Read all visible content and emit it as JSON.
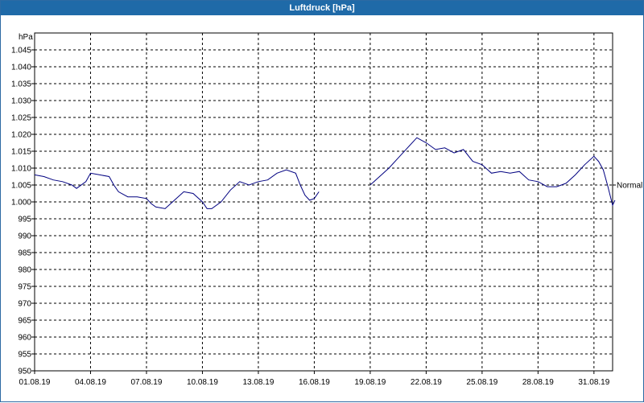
{
  "window": {
    "title": "Luftdruck [hPa]"
  },
  "chart_data": {
    "type": "line",
    "title": "Luftdruck [hPa]",
    "ylabel": "hPa",
    "xlabel": "",
    "ylim": [
      950,
      1050
    ],
    "y_ticks": [
      950,
      955,
      960,
      965,
      970,
      975,
      980,
      985,
      990,
      995,
      1000,
      1005,
      1010,
      1015,
      1020,
      1025,
      1030,
      1035,
      1040,
      1045
    ],
    "y_tick_labels": [
      "950",
      "955",
      "960",
      "965",
      "970",
      "975",
      "980",
      "985",
      "990",
      "995",
      "1.000",
      "1.005",
      "1.010",
      "1.015",
      "1.020",
      "1.025",
      "1.030",
      "1.035",
      "1.040",
      "1.045"
    ],
    "x_range": [
      "2019-08-01",
      "2019-09-01"
    ],
    "x_ticks": [
      "2019-08-01",
      "2019-08-04",
      "2019-08-07",
      "2019-08-10",
      "2019-08-13",
      "2019-08-16",
      "2019-08-19",
      "2019-08-22",
      "2019-08-25",
      "2019-08-28",
      "2019-08-31"
    ],
    "x_tick_labels": [
      "01.08.19",
      "04.08.19",
      "07.08.19",
      "10.08.19",
      "13.08.19",
      "16.08.19",
      "19.08.19",
      "22.08.19",
      "25.08.19",
      "28.08.19",
      "31.08.19"
    ],
    "grid": true,
    "line_color": "#000080",
    "series": [
      {
        "segments": [
          [
            [
              "2019-08-01 00:00",
              1008.0
            ],
            [
              "2019-08-01 12:00",
              1007.5
            ],
            [
              "2019-08-02 00:00",
              1006.5
            ],
            [
              "2019-08-02 12:00",
              1006.0
            ],
            [
              "2019-08-03 00:00",
              1005.0
            ],
            [
              "2019-08-03 06:00",
              1004.0
            ],
            [
              "2019-08-03 18:00",
              1006.0
            ],
            [
              "2019-08-04 00:00",
              1008.5
            ],
            [
              "2019-08-04 12:00",
              1008.0
            ],
            [
              "2019-08-05 00:00",
              1007.5
            ],
            [
              "2019-08-05 06:00",
              1005.0
            ],
            [
              "2019-08-05 12:00",
              1003.0
            ],
            [
              "2019-08-06 00:00",
              1001.5
            ],
            [
              "2019-08-06 12:00",
              1001.5
            ],
            [
              "2019-08-07 00:00",
              1001.0
            ],
            [
              "2019-08-07 06:00",
              999.5
            ],
            [
              "2019-08-07 12:00",
              998.5
            ],
            [
              "2019-08-08 00:00",
              998.0
            ],
            [
              "2019-08-08 12:00",
              1000.5
            ],
            [
              "2019-08-09 00:00",
              1003.0
            ],
            [
              "2019-08-09 12:00",
              1002.5
            ],
            [
              "2019-08-10 00:00",
              1000.0
            ],
            [
              "2019-08-10 06:00",
              998.0
            ],
            [
              "2019-08-10 12:00",
              998.0
            ],
            [
              "2019-08-11 00:00",
              1000.0
            ],
            [
              "2019-08-11 12:00",
              1003.5
            ],
            [
              "2019-08-12 00:00",
              1006.0
            ],
            [
              "2019-08-12 12:00",
              1005.0
            ],
            [
              "2019-08-13 00:00",
              1006.0
            ],
            [
              "2019-08-13 12:00",
              1006.5
            ],
            [
              "2019-08-14 00:00",
              1008.5
            ],
            [
              "2019-08-14 12:00",
              1009.5
            ],
            [
              "2019-08-15 00:00",
              1008.5
            ],
            [
              "2019-08-15 06:00",
              1005.0
            ],
            [
              "2019-08-15 12:00",
              1002.0
            ],
            [
              "2019-08-15 18:00",
              1000.5
            ],
            [
              "2019-08-16 00:00",
              1001.0
            ],
            [
              "2019-08-16 06:00",
              1003.0
            ]
          ],
          [
            [
              "2019-08-19 00:00",
              1005.0
            ],
            [
              "2019-08-19 12:00",
              1007.5
            ],
            [
              "2019-08-20 00:00",
              1010.0
            ],
            [
              "2019-08-20 12:00",
              1013.0
            ],
            [
              "2019-08-21 00:00",
              1016.0
            ],
            [
              "2019-08-21 12:00",
              1019.0
            ],
            [
              "2019-08-22 00:00",
              1017.5
            ],
            [
              "2019-08-22 12:00",
              1015.5
            ],
            [
              "2019-08-23 00:00",
              1016.0
            ],
            [
              "2019-08-23 12:00",
              1014.5
            ],
            [
              "2019-08-24 00:00",
              1015.5
            ],
            [
              "2019-08-24 12:00",
              1012.0
            ],
            [
              "2019-08-25 00:00",
              1011.0
            ],
            [
              "2019-08-25 12:00",
              1008.5
            ],
            [
              "2019-08-26 00:00",
              1009.0
            ],
            [
              "2019-08-26 12:00",
              1008.5
            ],
            [
              "2019-08-27 00:00",
              1009.0
            ],
            [
              "2019-08-27 12:00",
              1006.5
            ],
            [
              "2019-08-28 00:00",
              1006.0
            ],
            [
              "2019-08-28 12:00",
              1004.5
            ],
            [
              "2019-08-29 00:00",
              1004.5
            ],
            [
              "2019-08-29 12:00",
              1005.5
            ],
            [
              "2019-08-30 00:00",
              1008.0
            ],
            [
              "2019-08-30 12:00",
              1011.0
            ],
            [
              "2019-08-31 00:00",
              1013.5
            ],
            [
              "2019-08-31 06:00",
              1012.0
            ],
            [
              "2019-08-31 12:00",
              1009.5
            ],
            [
              "2019-08-31 18:00",
              1004.5
            ],
            [
              "2019-09-01 00:00",
              999.0
            ],
            [
              "2019-09-01 03:00",
              1000.5
            ]
          ]
        ]
      }
    ],
    "reference_lines": [
      {
        "label": "Normal",
        "value": 1005
      }
    ]
  }
}
